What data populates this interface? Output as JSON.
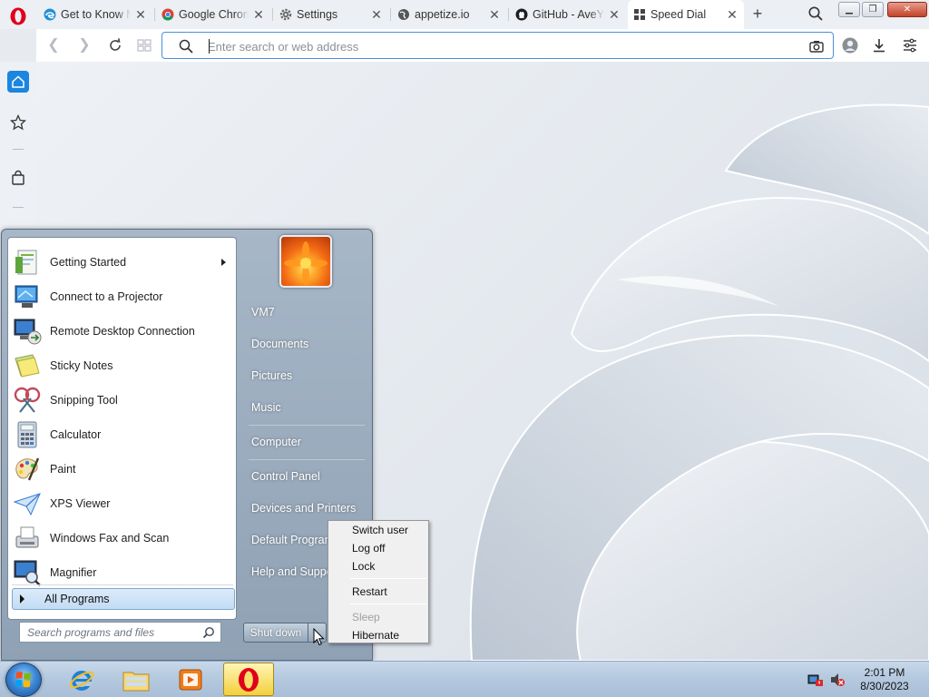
{
  "browser": {
    "tabs": [
      {
        "title": "Get to Know M",
        "icon": "edge-icon"
      },
      {
        "title": "Google Chrom",
        "icon": "chrome-icon"
      },
      {
        "title": "Settings",
        "icon": "gear-icon"
      },
      {
        "title": "appetize.io",
        "icon": "globe-icon"
      },
      {
        "title": "GitHub - AveY",
        "icon": "github-icon"
      },
      {
        "title": "Speed Dial",
        "icon": "grid-icon",
        "active": true
      }
    ],
    "address_placeholder": "Enter search or web address",
    "accent": "#1a86e0"
  },
  "start_menu": {
    "programs": [
      {
        "label": "Getting Started",
        "icon": "getting-started-icon",
        "has_submenu": true
      },
      {
        "label": "Connect to a Projector",
        "icon": "projector-icon"
      },
      {
        "label": "Remote Desktop Connection",
        "icon": "remote-desktop-icon"
      },
      {
        "label": "Sticky Notes",
        "icon": "sticky-notes-icon"
      },
      {
        "label": "Snipping Tool",
        "icon": "snipping-tool-icon"
      },
      {
        "label": "Calculator",
        "icon": "calculator-icon"
      },
      {
        "label": "Paint",
        "icon": "paint-icon"
      },
      {
        "label": "XPS Viewer",
        "icon": "xps-viewer-icon"
      },
      {
        "label": "Windows Fax and Scan",
        "icon": "fax-scan-icon"
      },
      {
        "label": "Magnifier",
        "icon": "magnifier-icon"
      }
    ],
    "all_programs_label": "All Programs",
    "search_placeholder": "Search programs and files",
    "places": [
      {
        "label": "VM7"
      },
      {
        "label": "Documents"
      },
      {
        "label": "Pictures"
      },
      {
        "label": "Music"
      },
      {
        "label": "Computer"
      },
      {
        "label": "Control Panel"
      },
      {
        "label": "Devices and Printers"
      },
      {
        "label": "Default Programs"
      },
      {
        "label": "Help and Support"
      }
    ],
    "shutdown_label": "Shut down"
  },
  "shutdown_menu": {
    "items": [
      {
        "label": "Switch user",
        "enabled": true
      },
      {
        "label": "Log off",
        "enabled": true
      },
      {
        "label": "Lock",
        "enabled": true
      },
      {
        "label": "Restart",
        "enabled": true
      },
      {
        "label": "Sleep",
        "enabled": false
      },
      {
        "label": "Hibernate",
        "enabled": true
      }
    ]
  },
  "taskbar": {
    "apps": [
      {
        "name": "internet-explorer-icon"
      },
      {
        "name": "file-explorer-icon"
      },
      {
        "name": "media-player-icon"
      },
      {
        "name": "opera-icon",
        "active": true
      }
    ],
    "time": "2:01 PM",
    "date": "8/30/2023"
  }
}
